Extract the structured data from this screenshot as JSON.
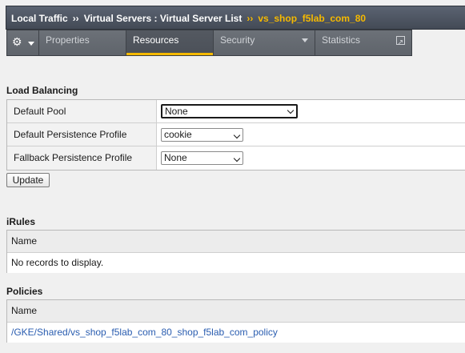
{
  "breadcrumb": {
    "root": "Local Traffic",
    "separator": "››",
    "middle": "Virtual Servers : Virtual Server List",
    "current": "vs_shop_f5lab_com_80"
  },
  "tabs": {
    "gear_icon": "gear-icon",
    "properties": "Properties",
    "resources": "Resources",
    "security": "Security",
    "statistics": "Statistics"
  },
  "load_balancing": {
    "title": "Load Balancing",
    "rows": [
      {
        "label": "Default Pool",
        "value": "None"
      },
      {
        "label": "Default Persistence Profile",
        "value": "cookie"
      },
      {
        "label": "Fallback Persistence Profile",
        "value": "None"
      }
    ],
    "update_label": "Update"
  },
  "irules": {
    "title": "iRules",
    "column": "Name",
    "empty_text": "No records to display."
  },
  "policies": {
    "title": "Policies",
    "column": "Name",
    "items": [
      "/GKE/Shared/vs_shop_f5lab_com_80_shop_f5lab_com_policy"
    ]
  },
  "colors": {
    "accent": "#f5b900",
    "link": "#2a5db0",
    "header_bg": "#4f5662"
  }
}
